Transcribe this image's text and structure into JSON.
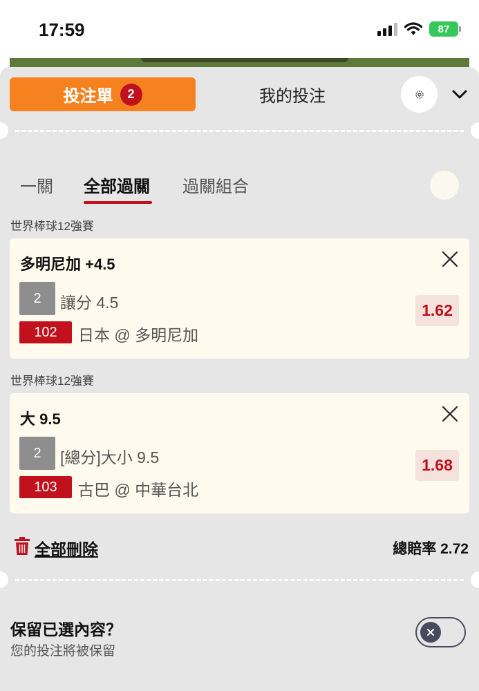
{
  "status_bar": {
    "time": "17:59",
    "battery": "87"
  },
  "header": {
    "betslip_label": "投注單",
    "betslip_count": "2",
    "mybets_label": "我的投注"
  },
  "subtabs": [
    {
      "label": "一關"
    },
    {
      "label": "全部過關"
    },
    {
      "label": "過關組合"
    }
  ],
  "bets": [
    {
      "league": "世界棒球12強賽",
      "title": "多明尼加 +4.5",
      "number": "2",
      "market": "讓分 4.5",
      "match_no": "102",
      "match": "日本 @ 多明尼加",
      "odds": "1.62"
    },
    {
      "league": "世界棒球12強賽",
      "title": "大 9.5",
      "number": "2",
      "market": "[總分]大小 9.5",
      "match_no": "103",
      "match": "古巴 @ 中華台北",
      "odds": "1.68"
    }
  ],
  "footer": {
    "delete_all": "全部刪除",
    "total_odds": "總賠率 2.72"
  },
  "retain": {
    "title": "保留已選內容？",
    "subtitle": "您的投注將被保留",
    "enabled": false
  },
  "colors": {
    "accent": "#f5821f",
    "red": "#c0111c",
    "sheet_bg": "#e6e6e6",
    "card_bg": "#fefbee"
  },
  "icons": [
    "signal-icon",
    "wifi-icon",
    "battery-icon",
    "gear-icon",
    "chevron-down-icon",
    "close-icon",
    "trash-icon",
    "toggle-off-icon"
  ]
}
